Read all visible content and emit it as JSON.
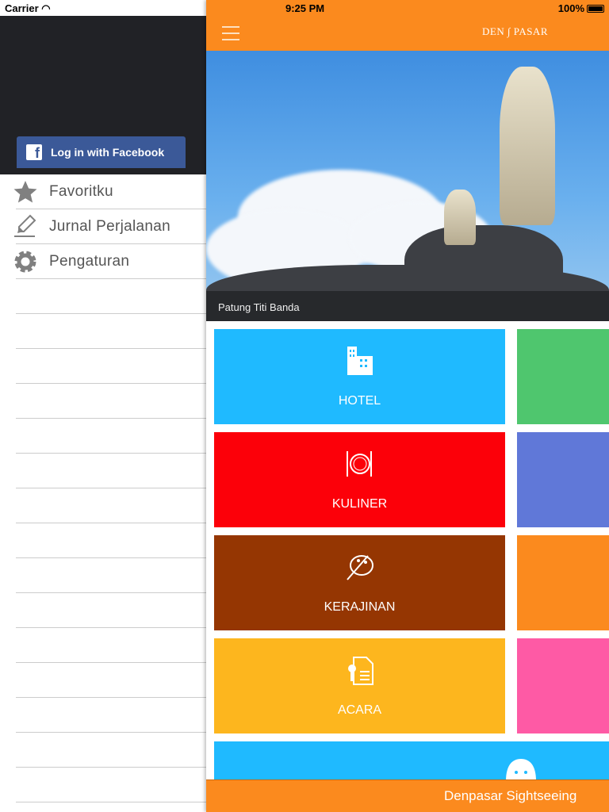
{
  "status": {
    "carrier": "Carrier",
    "time": "9:25 PM",
    "battery": "100%"
  },
  "sidebar": {
    "facebook_login": "Log in with Facebook",
    "items": [
      {
        "label": "Favoritku",
        "icon": "star-icon"
      },
      {
        "label": "Jurnal Perjalanan",
        "icon": "pencil-icon"
      },
      {
        "label": "Pengaturan",
        "icon": "gear-icon"
      }
    ]
  },
  "header": {
    "logo": "DENPASAR"
  },
  "hero": {
    "caption": "Patung Titi Banda"
  },
  "tiles": [
    {
      "label": "HOTEL",
      "color": "#1fbaff"
    },
    {
      "label": "KULINER",
      "color": "#fc0009"
    },
    {
      "label": "KERAJINAN",
      "color": "#953602"
    },
    {
      "label": "ACARA",
      "color": "#fdb61e"
    }
  ],
  "side_tiles": [
    "#4fc66e",
    "#6078d8",
    "#fb8a1e",
    "#fe5aa5"
  ],
  "footer": {
    "title": "Denpasar Sightseeing"
  }
}
